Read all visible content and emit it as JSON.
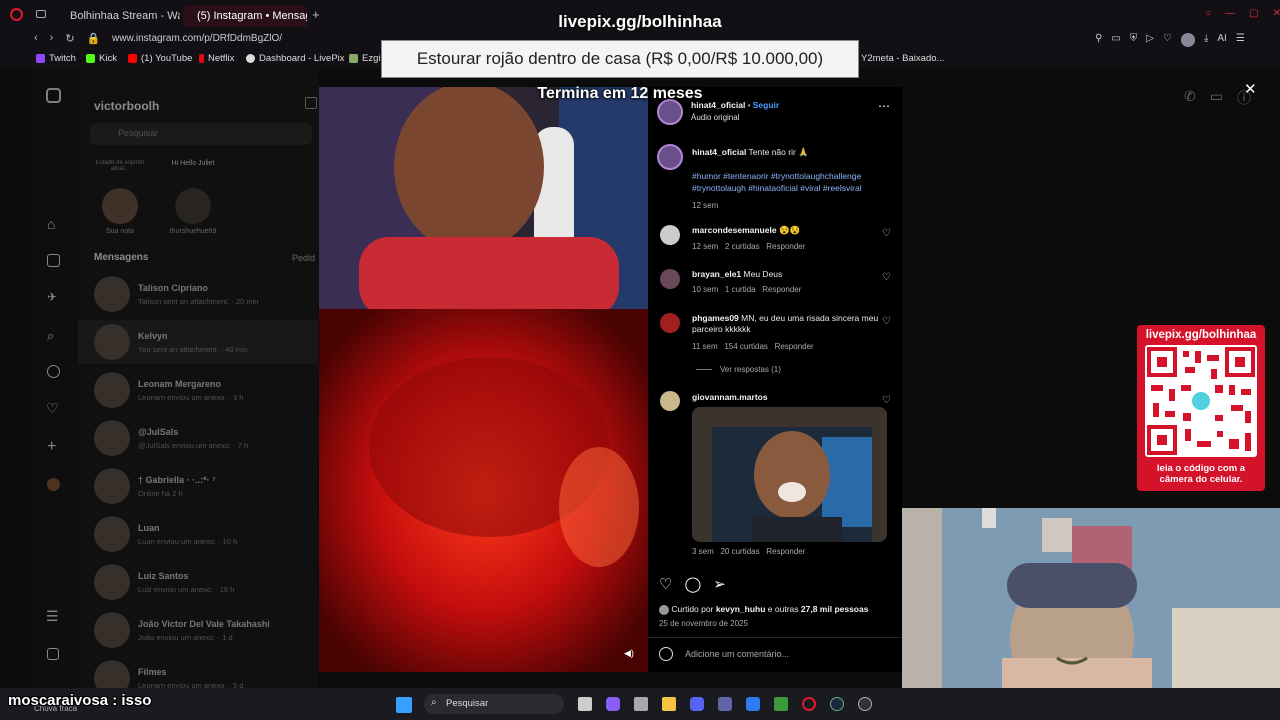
{
  "browser": {
    "tabs": [
      {
        "label": "Bolhinhaa Stream - Watch",
        "active": false
      },
      {
        "label": "(5) Instagram • Mensag",
        "active": true
      }
    ],
    "url": "www.instagram.com/p/DRfDdmBgZlO/",
    "bookmarks": [
      "Twitch",
      "Kick",
      "(1) YouTube",
      "Netflix",
      "Dashboard - LivePix",
      "Ezgi",
      "Y2meta - Baixado..."
    ],
    "right_label": "AI"
  },
  "overlay": {
    "streamer_link": "livepix.gg/bolhinhaa",
    "goal_text": "Estourar rojão dentro de casa (R$ 0,00/R$ 10.000,00)",
    "ends_text": "Termina em 12 meses",
    "qr_title": "livepix.gg/bolhinhaa",
    "qr_caption": "leia o código com a câmera do celular.",
    "chat_message": "moscaraivosa : isso"
  },
  "instagram": {
    "account": "victorboolh",
    "search_placeholder": "Pesquisar",
    "notes": [
      {
        "note": "Estado de espírito atual...",
        "name": "Sua nota"
      },
      {
        "note": "Hi Hello Juliet",
        "name": "thurshuehue69"
      }
    ],
    "messages_header": "Mensagens",
    "requests_label": "Pedid",
    "conversations": [
      {
        "name": "Talison Cipriano",
        "preview": "Talison sent an attachment. · 20 min"
      },
      {
        "name": "Kelvyn",
        "preview": "You sent an attachment. · 40 min"
      },
      {
        "name": "Leonam Mergareno",
        "preview": "Leonam enviou um anexo. · 3 h"
      },
      {
        "name": "@JulSals",
        "preview": "@JulSals enviou um anexo. · 7 h"
      },
      {
        "name": "† Gabriella · ·..:*· ⁷",
        "preview": "Online há 2 h"
      },
      {
        "name": "Luan",
        "preview": "Luan enviou um anexo. · 10 h"
      },
      {
        "name": "Luiz Santos",
        "preview": "Luiz enviou um anexo. · 16 h"
      },
      {
        "name": "João Victor Del Vale Takahashi",
        "preview": "João enviou um anexo. · 1 d"
      },
      {
        "name": "Filmes",
        "preview": "Leonam enviou um anexo. · 5 d"
      }
    ],
    "post": {
      "author": "hinat4_oficial",
      "follow_label": "Seguir",
      "audio": "Áudio original",
      "caption_user": "hinat4_oficial",
      "caption_text": "Tente não rir 🙏",
      "tags": "#humor #tentenaorir #trynottolaughchallenge #trynottolaugh #hinataoficial #viral #reelsviral",
      "caption_time": "12 sem",
      "comments": [
        {
          "user": "marcondesemanuele",
          "text": "😵😵",
          "time": "12 sem",
          "likes": "2 curtidas",
          "reply": "Responder"
        },
        {
          "user": "brayan_ele1",
          "text": "Meu Deus",
          "time": "10 sem",
          "likes": "1 curtida",
          "reply": "Responder"
        },
        {
          "user": "phgames09",
          "text": "MN, eu deu uma risada sincera meu parceiro kkkkkk",
          "time": "11 sem",
          "likes": "154 curtidas",
          "reply": "Responder"
        }
      ],
      "view_replies": "Ver respostas (1)",
      "gif_comment": {
        "user": "giovannam.martos",
        "time": "3 sem",
        "likes": "20 curtidas",
        "reply": "Responder"
      },
      "liked_by_prefix": "Curtido por",
      "liked_by_user": "kevyn_huhu",
      "liked_by_suffix": "e outras",
      "liked_by_count": "27,8 mil pessoas",
      "date": "25 de novembro de 2025",
      "comment_placeholder": "Adicione um comentário..."
    }
  },
  "taskbar": {
    "search_label": "Pesquisar",
    "weather": "Chuva fraca"
  }
}
